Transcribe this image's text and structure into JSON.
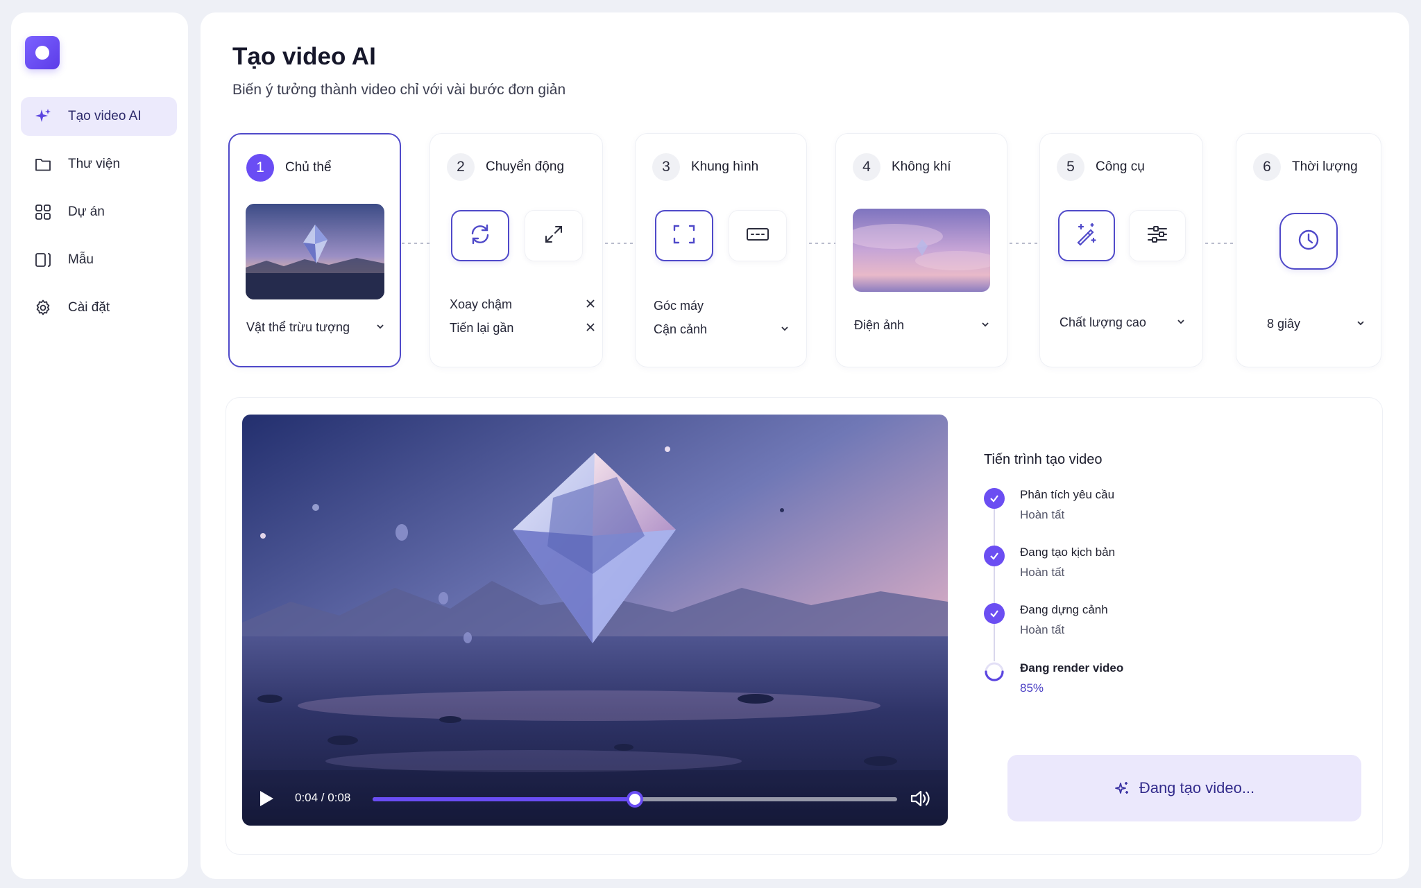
{
  "nav": {
    "items": [
      {
        "label": "Tạo video AI",
        "icon": "sparkle-icon"
      },
      {
        "label": "Thư viện",
        "icon": "folder-icon"
      },
      {
        "label": "Dự án",
        "icon": "grid-icon"
      },
      {
        "label": "Mẫu",
        "icon": "template-icon"
      },
      {
        "label": "Cài đặt",
        "icon": "gear-icon"
      }
    ]
  },
  "header": {
    "title": "Tạo video AI",
    "subtitle": "Biến ý tưởng thành video chỉ với vài bước đơn giản"
  },
  "steps": [
    {
      "num": "1",
      "title": "Chủ thể",
      "value": "Vật thể trừu tượng"
    },
    {
      "num": "2",
      "title": "Chuyển động",
      "options": [
        "Xoay chậm",
        "Tiến lại gần"
      ]
    },
    {
      "num": "3",
      "title": "Khung hình",
      "label": "Góc máy",
      "value": "Cận cảnh"
    },
    {
      "num": "4",
      "title": "Không khí",
      "value": "Điện ảnh"
    },
    {
      "num": "5",
      "title": "Công cụ",
      "value": "Chất lượng cao"
    },
    {
      "num": "6",
      "title": "Thời lượng",
      "value": "8 giây"
    }
  ],
  "player": {
    "time": "0:04 / 0:08",
    "progress": 0.5
  },
  "progress": {
    "title": "Tiến trình tạo video",
    "items": [
      {
        "name": "Phân tích yêu cầu",
        "status": "Hoàn tất"
      },
      {
        "name": "Đang tạo kịch bản",
        "status": "Hoàn tất"
      },
      {
        "name": "Đang dựng cảnh",
        "status": "Hoàn tất"
      },
      {
        "name": "Đang render video",
        "status": "85%"
      }
    ],
    "render_percent": 85
  },
  "generate_button": "Đang tạo video...",
  "colors": {
    "accent": "#6a4df4",
    "accent_dark": "#4f49c9",
    "button_bg": "#ebe8fc"
  }
}
